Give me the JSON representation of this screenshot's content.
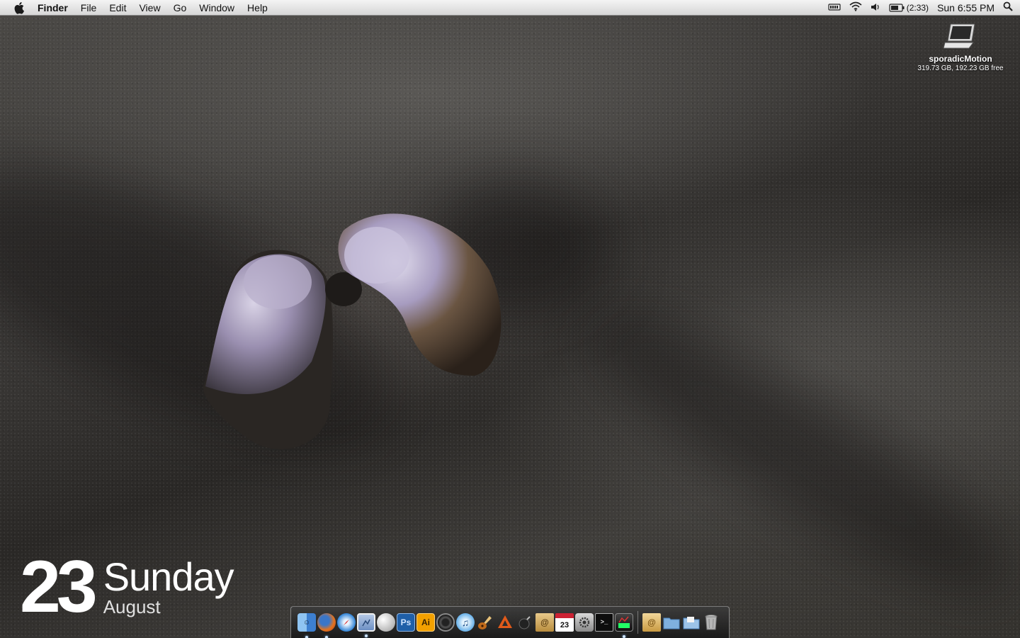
{
  "menubar": {
    "app_name": "Finder",
    "menus": [
      "File",
      "Edit",
      "View",
      "Go",
      "Window",
      "Help"
    ],
    "battery_time": "(2:33)",
    "clock": "Sun 6:55 PM"
  },
  "desktop": {
    "volume_name": "sporadicMotion",
    "volume_info": "319.73 GB, 192.23 GB free"
  },
  "date_widget": {
    "day": "23",
    "weekday": "Sunday",
    "month": "August"
  },
  "dock": {
    "colors": {
      "photoshop": "#1f5fa8",
      "illustrator": "#f2a000"
    },
    "photoshop_label": "Ps",
    "illustrator_label": "Ai",
    "calendar_day": "23"
  }
}
